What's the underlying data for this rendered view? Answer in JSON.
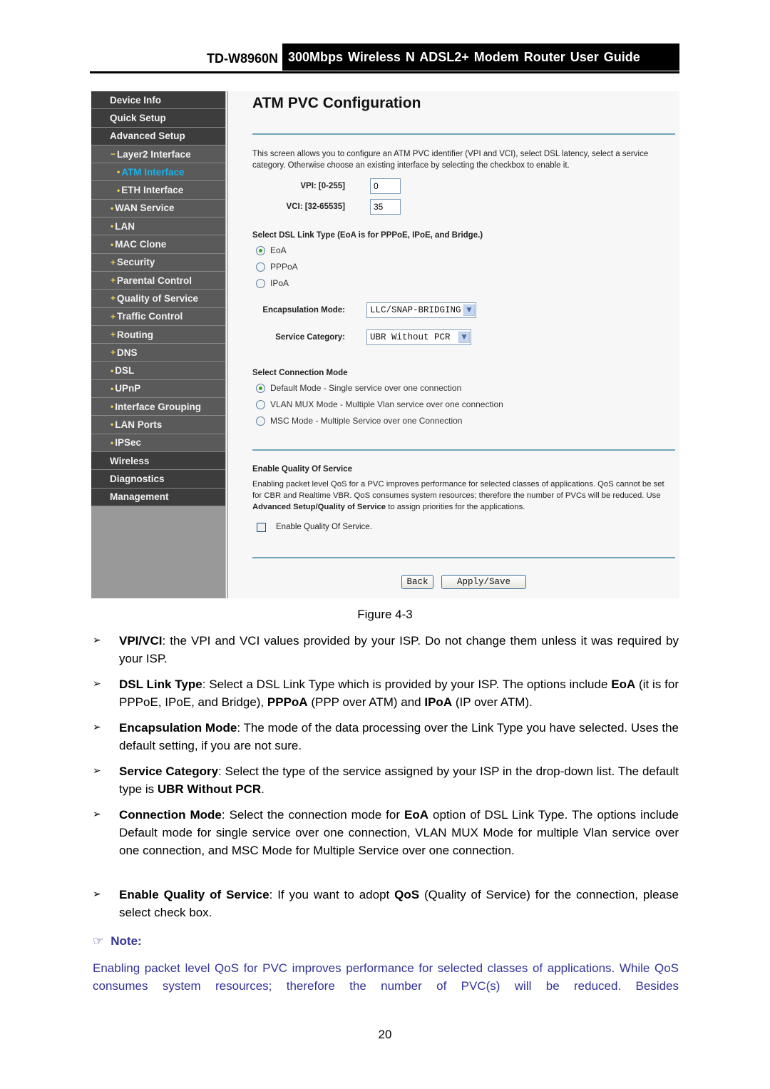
{
  "header": {
    "model": "TD-W8960N",
    "guide_title": "300Mbps Wireless N ADSL2+ Modem Router User Guide"
  },
  "sidebar": {
    "items": [
      {
        "label": "Device Info",
        "level": "top",
        "mark": ""
      },
      {
        "label": "Quick Setup",
        "level": "top",
        "mark": ""
      },
      {
        "label": "Advanced Setup",
        "level": "top",
        "mark": ""
      },
      {
        "label": "Layer2 Interface",
        "level": "sub",
        "mark": "−"
      },
      {
        "label": "ATM Interface",
        "level": "sub2",
        "mark": "•",
        "active": true
      },
      {
        "label": "ETH Interface",
        "level": "sub2",
        "mark": "•"
      },
      {
        "label": "WAN Service",
        "level": "sub",
        "mark": "•"
      },
      {
        "label": "LAN",
        "level": "sub",
        "mark": "•"
      },
      {
        "label": "MAC Clone",
        "level": "sub",
        "mark": "•"
      },
      {
        "label": "Security",
        "level": "sub",
        "mark": "+"
      },
      {
        "label": "Parental Control",
        "level": "sub",
        "mark": "+"
      },
      {
        "label": "Quality of Service",
        "level": "sub",
        "mark": "+"
      },
      {
        "label": "Traffic Control",
        "level": "sub",
        "mark": "+"
      },
      {
        "label": "Routing",
        "level": "sub",
        "mark": "+"
      },
      {
        "label": "DNS",
        "level": "sub",
        "mark": "+"
      },
      {
        "label": "DSL",
        "level": "sub",
        "mark": "•"
      },
      {
        "label": "UPnP",
        "level": "sub",
        "mark": "•"
      },
      {
        "label": "Interface Grouping",
        "level": "sub",
        "mark": "•"
      },
      {
        "label": "LAN Ports",
        "level": "sub",
        "mark": "•"
      },
      {
        "label": "IPSec",
        "level": "sub",
        "mark": "•"
      },
      {
        "label": "Wireless",
        "level": "top",
        "mark": ""
      },
      {
        "label": "Diagnostics",
        "level": "top",
        "mark": ""
      },
      {
        "label": "Management",
        "level": "top",
        "mark": ""
      }
    ]
  },
  "config": {
    "page_title": "ATM PVC Configuration",
    "intro": "This screen allows you to configure an ATM PVC identifier (VPI and VCI), select DSL latency, select a service category. Otherwise choose an existing interface by selecting the checkbox to enable it.",
    "vpi_label": "VPI: [0-255]",
    "vpi_value": "0",
    "vci_label": "VCI: [32-65535]",
    "vci_value": "35",
    "link_type_heading": "Select DSL Link Type (EoA is for PPPoE, IPoE, and Bridge.)",
    "link_types": [
      {
        "label": "EoA",
        "checked": true
      },
      {
        "label": "PPPoA",
        "checked": false
      },
      {
        "label": "IPoA",
        "checked": false
      }
    ],
    "encapsulation_label": "Encapsulation Mode:",
    "encapsulation_value": "LLC/SNAP-BRIDGING",
    "service_category_label": "Service Category:",
    "service_category_value": "UBR Without PCR",
    "connection_mode_heading": "Select Connection Mode",
    "connection_modes": [
      {
        "label": "Default Mode - Single service over one connection",
        "checked": true
      },
      {
        "label": "VLAN MUX Mode - Multiple Vlan service over one connection",
        "checked": false
      },
      {
        "label": "MSC Mode - Multiple Service over one Connection",
        "checked": false
      }
    ],
    "qos_heading": "Enable Quality Of Service",
    "qos_desc_1": "Enabling packet level QoS for a PVC improves performance for selected classes of applications.  QoS cannot be set for CBR and Realtime VBR.  QoS consumes system resources; therefore the number of PVCs will be reduced. Use ",
    "qos_desc_bold": "Advanced Setup/Quality of Service",
    "qos_desc_2": " to assign priorities for the applications.",
    "qos_checkbox_label": "Enable Quality Of Service.",
    "qos_checked": false,
    "back_label": "Back",
    "apply_label": "Apply/Save",
    "dropdown_arrow_icon": "chevron-down"
  },
  "doc": {
    "caption": "Figure 4-3",
    "bullet_icon": "➢",
    "bullets": [
      {
        "term": "VPI/VCI",
        "text": ": the VPI and VCI values provided by your ISP. Do not change them unless it was required by your ISP."
      },
      {
        "term": "DSL Link Type",
        "text_1": ": Select a DSL Link Type which is provided by your ISP. The options include ",
        "b1": "EoA",
        "text_2": " (it is for PPPoE, IPoE, and Bridge), ",
        "b2": "PPPoA",
        "text_3": " (PPP over ATM) and ",
        "b3": "IPoA",
        "text_4": " (IP over ATM)."
      },
      {
        "term": "Encapsulation Mode",
        "text": ": The mode of the data processing over the Link Type you have selected. Uses the default setting, if you are not sure."
      },
      {
        "term": "Service Category",
        "text": ": Select the type of the service assigned by your ISP in the drop-down list. The default type is ",
        "b1": "UBR Without PCR",
        "text_2": "."
      },
      {
        "term": "Connection Mode",
        "text": ": Select the connection mode for ",
        "b1": "EoA",
        "text_2": " option of DSL Link Type. The options include Default mode for single service over one connection, VLAN MUX Mode for multiple Vlan service over one connection, and MSC Mode for Multiple Service over one connection."
      },
      {
        "term": "Enable Quality of Service",
        "text": ": If you want to adopt ",
        "b1": "QoS",
        "text_2": " (Quality of Service) for the connection, please select check box."
      }
    ],
    "note_icon": "☞",
    "note_label": "Note:",
    "note_text": "Enabling packet level QoS for PVC improves performance for selected classes of applications. While QoS consumes system resources; therefore the number of PVC(s) will be reduced. Besides",
    "page_number": "20"
  }
}
